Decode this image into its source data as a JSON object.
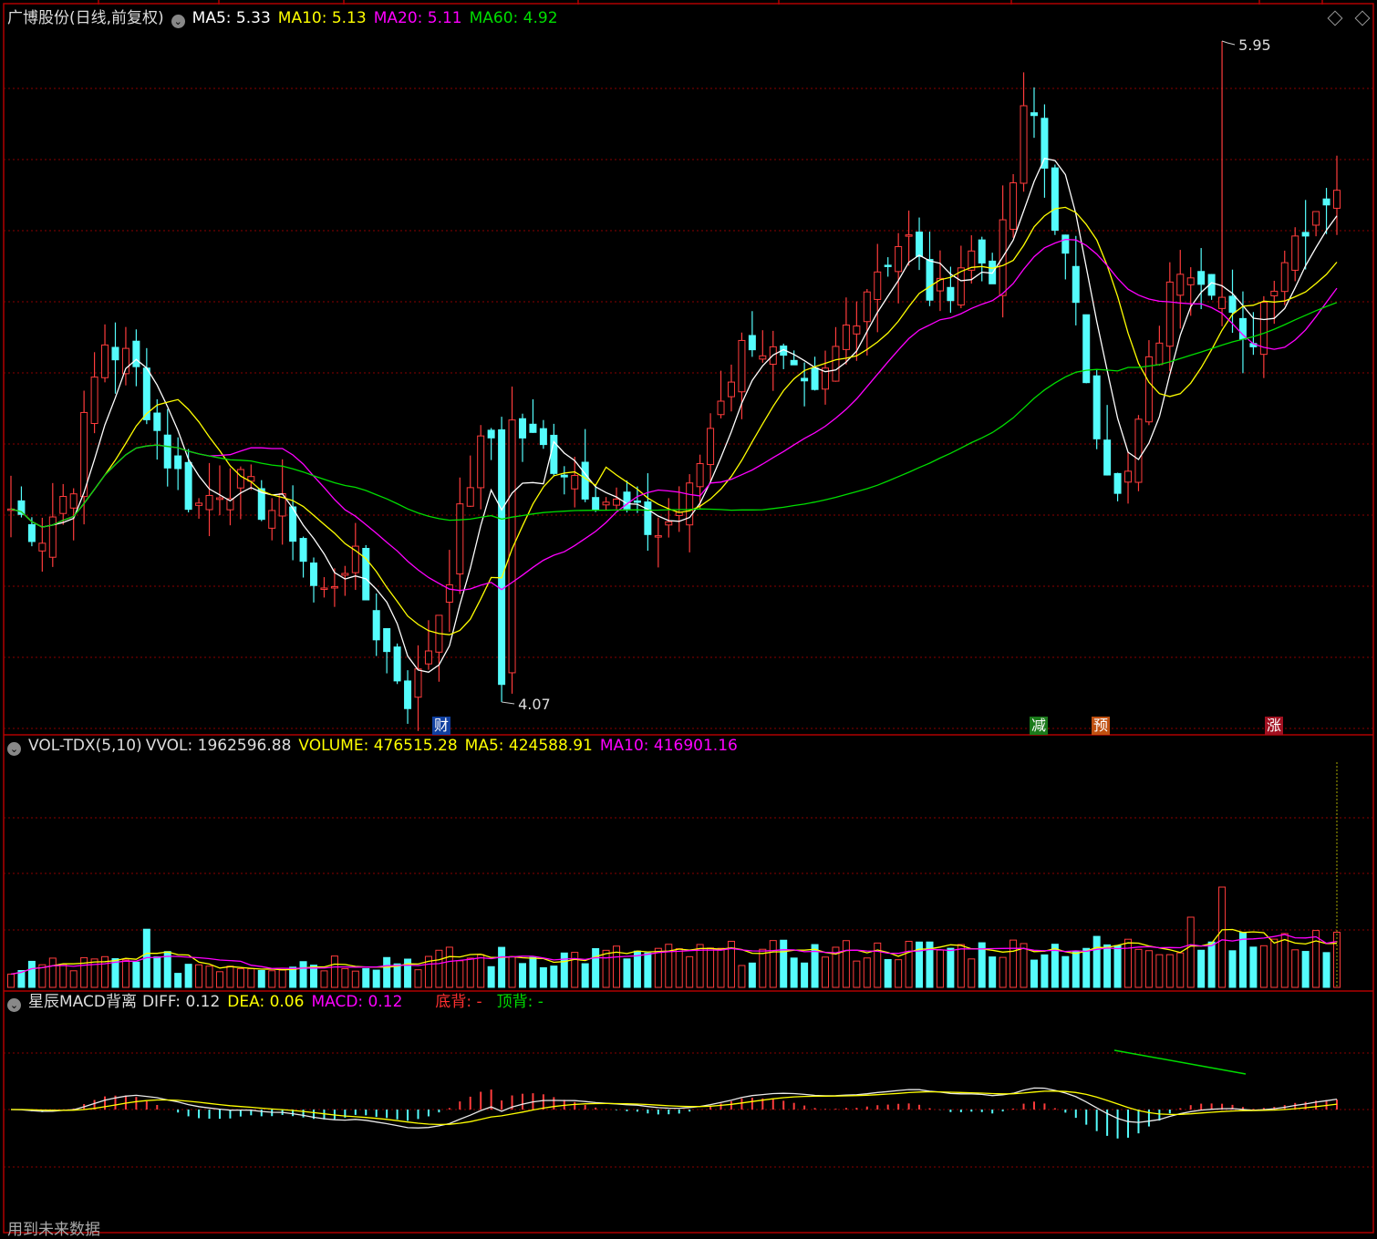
{
  "main_panel": {
    "title": "广博股份(日线,前复权)",
    "ma5": "MA5: 5.33",
    "ma10": "MA10: 5.13",
    "ma20": "MA20: 5.11",
    "ma60": "MA60: 4.92",
    "high_label": "5.95",
    "low_label": "4.07",
    "markers": {
      "cai": "财",
      "jian": "减",
      "yu": "预",
      "zhang": "涨"
    }
  },
  "volume_panel": {
    "title": "VOL-TDX(5,10)",
    "vvol": "VVOL: 1962596.88",
    "volume": "VOLUME: 476515.28",
    "ma5": "MA5: 424588.91",
    "ma10": "MA10: 416901.16"
  },
  "macd_panel": {
    "title": "星辰MACD背离",
    "diff": "DIFF: 0.12",
    "dea": "DEA: 0.06",
    "macd": "MACD: 0.12",
    "bottom_div": "底背: -",
    "top_div": "顶背: -"
  },
  "footer_text": "用到未来数据",
  "colors": {
    "up": "#ff3c3c",
    "down": "#54fcfc",
    "ma5": "#ffffff",
    "ma10": "#ffff00",
    "ma20": "#ff00ff",
    "ma60": "#00dd00",
    "grid": "#8a0000",
    "border": "#b00000"
  },
  "chart_data": [
    {
      "type": "candlestick",
      "description_note": "",
      "ohlc_keypoints": [
        {
          "close": 4.62
        },
        {
          "close": 4.55
        },
        {
          "close": 4.7
        },
        {
          "close": 5.1
        },
        {
          "close": 5.02
        },
        {
          "close": 4.78
        },
        {
          "close": 4.62
        },
        {
          "close": 4.71
        },
        {
          "close": 4.64
        },
        {
          "close": 4.6
        },
        {
          "close": 4.35
        },
        {
          "close": 4.5
        },
        {
          "close": 4.24
        },
        {
          "close": 4.07
        },
        {
          "close": 4.37
        },
        {
          "close": 4.75
        },
        {
          "close": 4.88
        },
        {
          "close": 4.8
        },
        {
          "close": 4.74
        },
        {
          "close": 4.67
        },
        {
          "close": 4.6
        },
        {
          "close": 4.55
        },
        {
          "close": 4.65
        },
        {
          "close": 4.95
        },
        {
          "close": 5.12
        },
        {
          "close": 5.02
        },
        {
          "close": 4.9
        },
        {
          "close": 5.12
        },
        {
          "close": 5.3
        },
        {
          "close": 5.4
        },
        {
          "close": 5.2
        },
        {
          "close": 5.35
        },
        {
          "close": 5.3
        },
        {
          "close": 5.8
        },
        {
          "close": 5.4
        },
        {
          "close": 4.95
        },
        {
          "close": 4.6
        },
        {
          "close": 5.05
        },
        {
          "close": 5.35
        },
        {
          "close": 5.28
        },
        {
          "close": 5.05
        },
        {
          "close": 5.3
        },
        {
          "close": 5.45
        },
        {
          "close": 5.55
        }
      ],
      "price_high": 5.95,
      "price_low": 4.07
    },
    {
      "type": "bar",
      "name": "VOLUME",
      "note": ""
    },
    {
      "type": "bar",
      "name": "MACD"
    }
  ]
}
